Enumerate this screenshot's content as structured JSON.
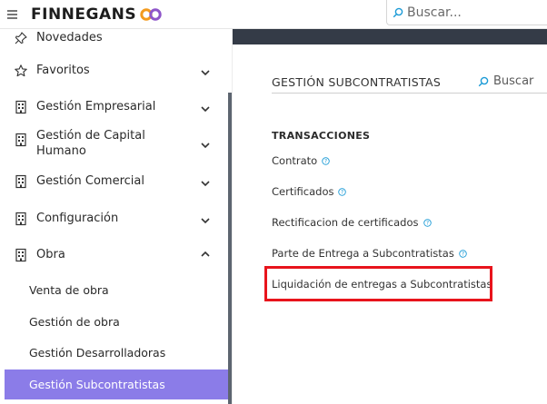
{
  "header": {
    "logo_text": "FINNEGANS",
    "search_placeholder": "Buscar..."
  },
  "sidebar": {
    "items": [
      {
        "label": "Novedades",
        "icon": "pin-icon"
      },
      {
        "label": "Favoritos",
        "icon": "star-icon"
      },
      {
        "label": "Gestión Empresarial",
        "icon": "building-icon"
      },
      {
        "label": "Gestión de Capital Humano",
        "label_line1": "Gestión de Capital",
        "label_line2": "Humano",
        "icon": "building-icon"
      },
      {
        "label": "Gestión Comercial",
        "icon": "building-icon"
      },
      {
        "label": "Configuración",
        "icon": "building-icon"
      },
      {
        "label": "Obra",
        "icon": "building-icon",
        "expanded": true
      }
    ],
    "subitems": [
      {
        "label": "Venta de obra"
      },
      {
        "label": "Gestión de obra"
      },
      {
        "label": "Gestión Desarrolladoras"
      },
      {
        "label": "Gestión Subcontratistas",
        "active": true
      }
    ],
    "active_color": "#8b7ce8"
  },
  "main": {
    "title": "GESTIÓN SUBCONTRATISTAS",
    "search_label": "Buscar",
    "section_title": "TRANSACCIONES",
    "links": [
      {
        "label": "Contrato",
        "has_help": true
      },
      {
        "label": "Certificados",
        "has_help": true
      },
      {
        "label": "Rectificacion de certificados",
        "has_help": true
      },
      {
        "label": "Parte de Entrega a Subcontratistas",
        "has_help": true
      },
      {
        "label": "Liquidación de entregas a Subcontratistas",
        "has_help": false,
        "highlighted": true
      }
    ],
    "accent_color": "#1a9ad6",
    "highlight_color": "#e8141c"
  }
}
